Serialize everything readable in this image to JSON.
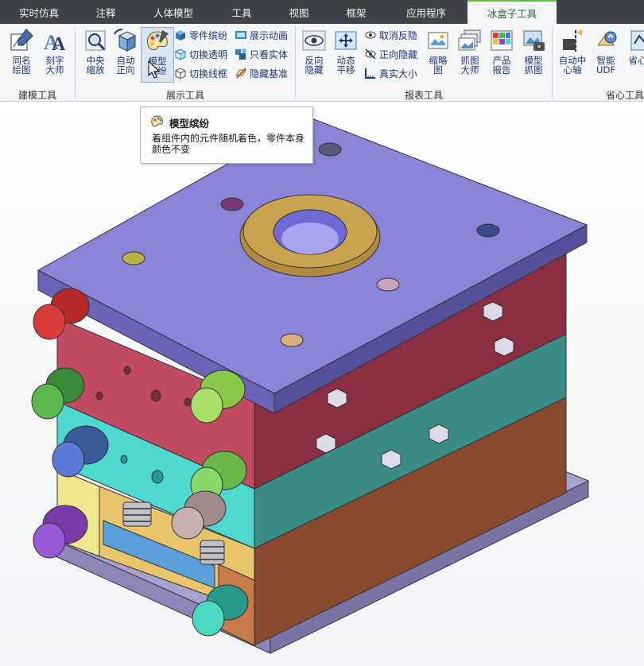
{
  "tabs": [
    {
      "label": "实时仿真",
      "active": false
    },
    {
      "label": "注释",
      "active": false
    },
    {
      "label": "人体模型",
      "active": false
    },
    {
      "label": "工具",
      "active": false
    },
    {
      "label": "视图",
      "active": false
    },
    {
      "label": "框架",
      "active": false
    },
    {
      "label": "应用程序",
      "active": false
    },
    {
      "label": "冰盒子工具",
      "active": true
    }
  ],
  "ribbon": {
    "groups": {
      "modeling": {
        "label": "建模工具",
        "buttons": [
          "同名\n绘图",
          "刻字\n大师"
        ]
      },
      "display": {
        "label": "展示工具",
        "big_buttons": [
          "中央\n缩放",
          "自动\n正向",
          "模型\n缤纷"
        ],
        "small_buttons": [
          "零件缤纷",
          "切换透明",
          "切换线框",
          "展示动画",
          "只看实体",
          "隐藏基准"
        ]
      },
      "report": {
        "label": "报表工具",
        "big_buttons": [
          "反向\n隐藏",
          "动态\n平移"
        ],
        "small_buttons": [
          "取消反隐",
          "正向隐藏",
          "真实大小"
        ],
        "big_buttons2": [
          "缩略\n图",
          "抓图\n大师",
          "产品\n报告",
          "模型\n抓图"
        ]
      },
      "save_effort": {
        "label": "省心工具",
        "big_buttons": [
          "自动中\n心轴",
          "智能\nUDF",
          "省心"
        ]
      }
    }
  },
  "tooltip": {
    "title": "模型缤纷",
    "description": "着组件内的元件随机着色，零件本身颜色不变"
  },
  "model": {
    "top_plate_color": "#8a84d8",
    "red_plate_color": "#c24a62",
    "cyan_plate_color": "#4fd8d0",
    "brown_plate_color": "#8a4a2e",
    "base_color": "#a8a2cf",
    "ring_color": "#b08a3e"
  }
}
